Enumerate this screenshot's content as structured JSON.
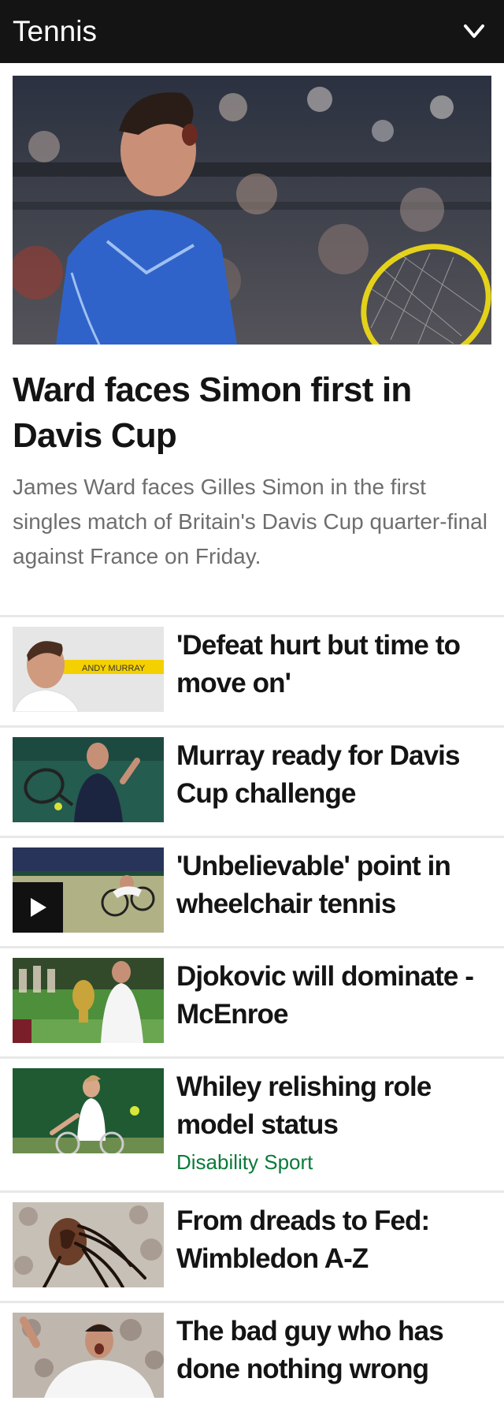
{
  "header": {
    "title": "Tennis",
    "menu_icon": "chevron-down-icon"
  },
  "colors": {
    "header_bg": "#141414",
    "tag": "#0b7a3a",
    "summary": "#6e6e6e"
  },
  "hero": {
    "title": "Ward faces Simon first in Davis Cup",
    "summary": "James Ward faces Gilles Simon in the first singles match of Britain's Davis Cup quarter-final against France on Friday."
  },
  "stories": [
    {
      "title": "'Defeat hurt but time to move on'",
      "thumb_caption": "ANDY MURRAY"
    },
    {
      "title": "Murray ready for Davis Cup challenge"
    },
    {
      "title": "'Unbelievable' point in wheelchair tennis",
      "media": "video"
    },
    {
      "title": "Djokovic will dominate - McEnroe"
    },
    {
      "title": "Whiley relishing role model status",
      "tag": "Disability Sport"
    },
    {
      "title": "From dreads to Fed: Wimbledon A-Z"
    },
    {
      "title": "The bad guy who has done nothing wrong"
    }
  ]
}
